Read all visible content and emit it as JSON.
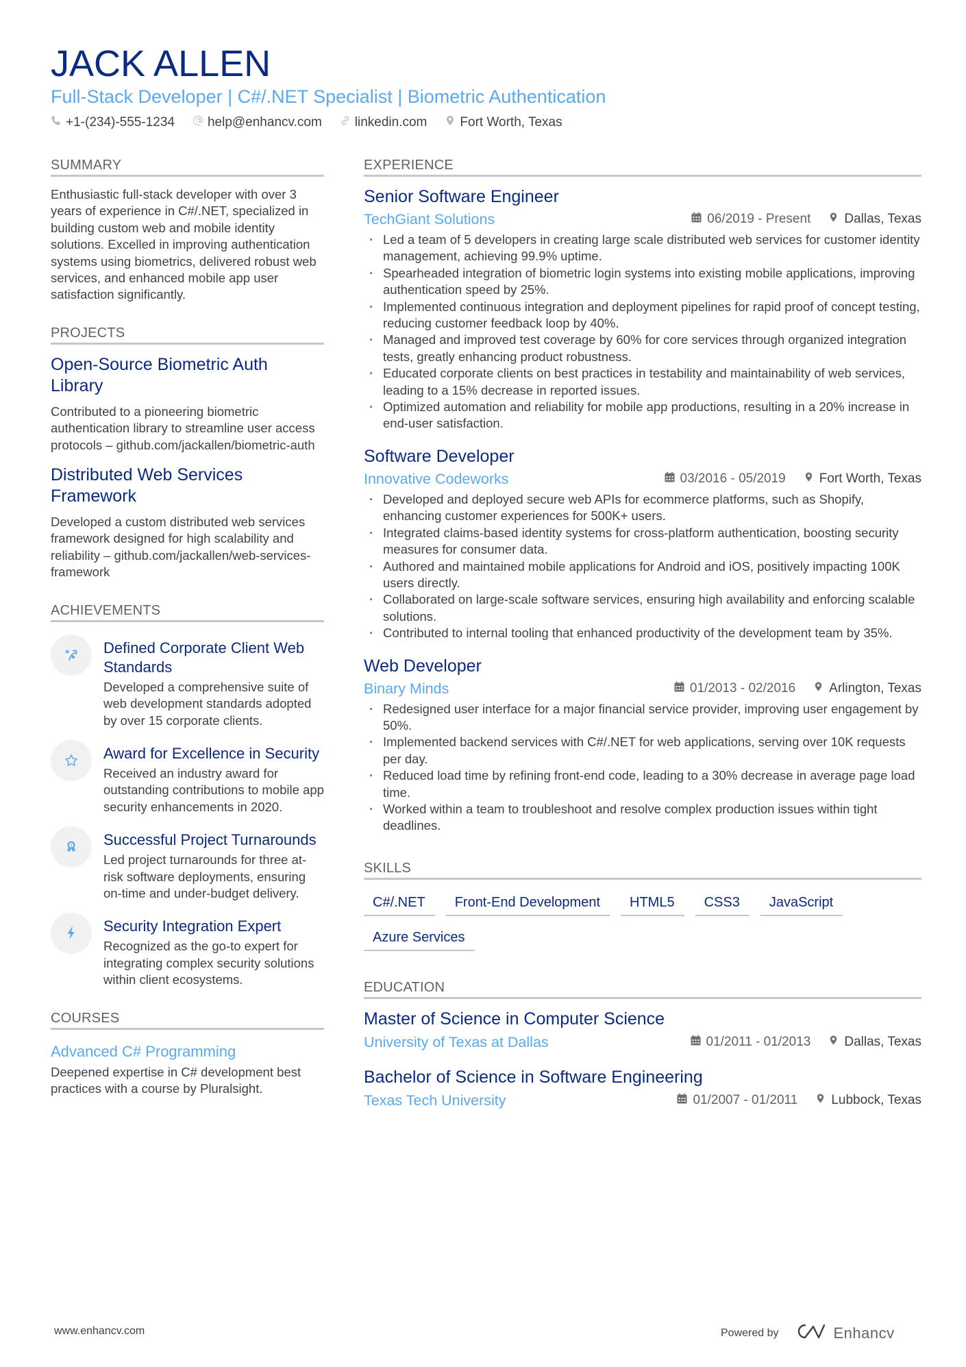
{
  "header": {
    "name": "JACK ALLEN",
    "title": "Full-Stack Developer | C#/.NET Specialist | Biometric Authentication",
    "contacts": [
      {
        "icon": "phone-icon",
        "text": "+1-(234)-555-1234"
      },
      {
        "icon": "at-icon",
        "text": "help@enhancv.com"
      },
      {
        "icon": "link-icon",
        "text": "linkedin.com"
      },
      {
        "icon": "location-pin-icon",
        "text": "Fort Worth, Texas"
      }
    ]
  },
  "summary": {
    "heading": "SUMMARY",
    "text": "Enthusiastic full-stack developer with over 3 years of experience in C#/.NET, specialized in building custom web and mobile identity solutions. Excelled in improving authentication systems using biometrics, delivered robust web services, and enhanced mobile app user satisfaction significantly."
  },
  "projects": {
    "heading": "PROJECTS",
    "items": [
      {
        "title": "Open-Source Biometric Auth Library",
        "description": "Contributed to a pioneering biometric authentication library to streamline user access protocols – github.com/jackallen/biometric-auth"
      },
      {
        "title": "Distributed Web Services Framework",
        "description": "Developed a custom distributed web services framework designed for high scalability and reliability – github.com/jackallen/web-services-framework"
      }
    ]
  },
  "achievements": {
    "heading": "ACHIEVEMENTS",
    "items": [
      {
        "icon": "strategy-icon",
        "title": "Defined Corporate Client Web Standards",
        "description": "Developed a comprehensive suite of web development standards adopted by over 15 corporate clients."
      },
      {
        "icon": "star-icon",
        "title": "Award for Excellence in Security",
        "description": "Received an industry award for outstanding contributions to mobile app security enhancements in 2020."
      },
      {
        "icon": "medal-icon",
        "title": "Successful Project Turnarounds",
        "description": "Led project turnarounds for three at-risk software deployments, ensuring on-time and under-budget delivery."
      },
      {
        "icon": "lightning-icon",
        "title": "Security Integration Expert",
        "description": "Recognized as the go-to expert for integrating complex security solutions within client ecosystems."
      }
    ]
  },
  "courses": {
    "heading": "COURSES",
    "items": [
      {
        "title": "Advanced C# Programming",
        "description": "Deepened expertise in C# development best practices with a course by Pluralsight."
      }
    ]
  },
  "experience": {
    "heading": "EXPERIENCE",
    "jobs": [
      {
        "title": "Senior Software Engineer",
        "company": "TechGiant Solutions",
        "dates": "06/2019 - Present",
        "location": "Dallas, Texas",
        "bullets": [
          "Led a team of 5 developers in creating large scale distributed web services for customer identity management, achieving 99.9% uptime.",
          "Spearheaded integration of biometric login systems into existing mobile applications, improving authentication speed by 25%.",
          "Implemented continuous integration and deployment pipelines for rapid proof of concept testing, reducing customer feedback loop by 40%.",
          "Managed and improved test coverage by 60% for core services through organized integration tests, greatly enhancing product robustness.",
          "Educated corporate clients on best practices in testability and maintainability of web services, leading to a 15% decrease in reported issues.",
          "Optimized automation and reliability for mobile app productions, resulting in a 20% increase in end-user satisfaction."
        ]
      },
      {
        "title": "Software Developer",
        "company": "Innovative Codeworks",
        "dates": "03/2016 - 05/2019",
        "location": "Fort Worth, Texas",
        "bullets": [
          "Developed and deployed secure web APIs for ecommerce platforms, such as Shopify, enhancing customer experiences for 500K+ users.",
          "Integrated claims-based identity systems for cross-platform authentication, boosting security measures for consumer data.",
          "Authored and maintained mobile applications for Android and iOS, positively impacting 100K users directly.",
          "Collaborated on large-scale software services, ensuring high availability and enforcing scalable solutions.",
          "Contributed to internal tooling that enhanced productivity of the development team by 35%."
        ]
      },
      {
        "title": "Web Developer",
        "company": "Binary Minds",
        "dates": "01/2013 - 02/2016",
        "location": "Arlington, Texas",
        "bullets": [
          "Redesigned user interface for a major financial service provider, improving user engagement by 50%.",
          "Implemented backend services with C#/.NET for web applications, serving over 10K requests per day.",
          "Reduced load time by refining front-end code, leading to a 30% decrease in average page load time.",
          "Worked within a team to troubleshoot and resolve complex production issues within tight deadlines."
        ]
      }
    ]
  },
  "skills": {
    "heading": "SKILLS",
    "items": [
      "C#/.NET",
      "Front-End Development",
      "HTML5",
      "CSS3",
      "JavaScript",
      "Azure Services"
    ]
  },
  "education": {
    "heading": "EDUCATION",
    "items": [
      {
        "degree": "Master of Science in Computer Science",
        "school": "University of Texas at Dallas",
        "dates": "01/2011 - 01/2013",
        "location": "Dallas, Texas"
      },
      {
        "degree": "Bachelor of Science in Software Engineering",
        "school": "Texas Tech University",
        "dates": "01/2007 - 01/2011",
        "location": "Lubbock, Texas"
      }
    ]
  },
  "footer": {
    "url": "www.enhancv.com",
    "powered_by": "Powered by",
    "brand": "Enhancv"
  },
  "colors": {
    "name": "#0b2a80",
    "accent": "#5aa8ee",
    "text": "#3c4349",
    "rule": "#c4c7ca",
    "icon_bg": "#f1f1f2"
  }
}
